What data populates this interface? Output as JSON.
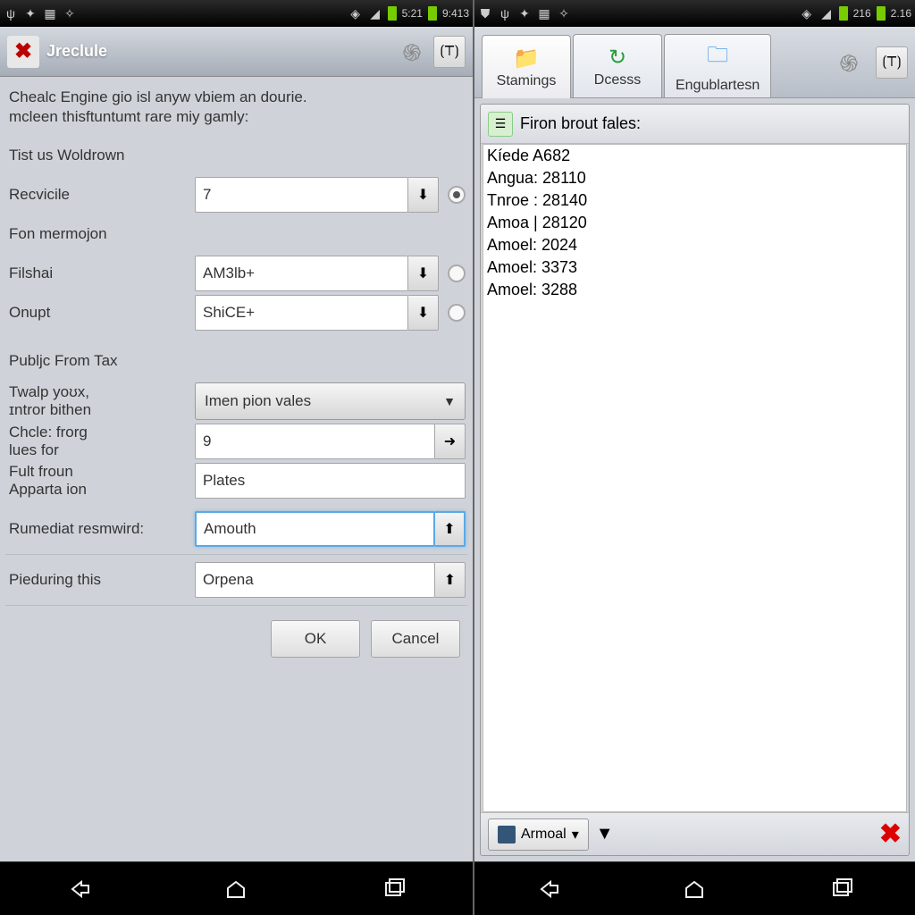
{
  "left": {
    "status": {
      "time": "5:21",
      "extra": "9:413"
    },
    "title": "Jreclule",
    "intro1": "Chealc Engine gio isl anyw vbiem an dourie.",
    "intro2": "mcleen thisftuntumt rare miy gamly:",
    "rows": {
      "woldrown": "Tist us Woldrown",
      "recvicile": "Recvicile",
      "recvicile_val": "7",
      "fon": "Fon mermojon",
      "filshal": "Filshai",
      "filshal_val": "AM3lb+",
      "onupt": "Onupt",
      "onupt_val": "ShiCE+",
      "publiq": "Publjc From Tax",
      "twalp": "Twalp yoʊx,",
      "intror": "ɪntror bithen",
      "select_val": "Imen pion vales",
      "chcle": "Chcle: frorg",
      "chcle_val": "9",
      "lues": "lues for",
      "fult": "Fult froun",
      "fult_val": "Plates",
      "apparta": "Apparta ion",
      "rumediat": "Rumediat resmwird:",
      "rumediat_val": "Amouth",
      "pieduring": "Pieduring this",
      "pieduring_val": "Orpena"
    },
    "buttons": {
      "ok": "OK",
      "cancel": "Cancel"
    }
  },
  "right": {
    "status": {
      "sig": "216",
      "bat": "2.16"
    },
    "tabs": {
      "t1": "Stamings",
      "t2": "Dcesss",
      "t3": "Engublartesn"
    },
    "panel_title": "Firon brout fales:",
    "items": [
      "Kíede A682",
      "Angua: 28110",
      "Tnroe : 28140",
      "Amoa | 28120",
      "Amoel: 2024",
      "Amoel: 3373",
      "Amoel: 3288"
    ],
    "foot_label": "Armoal"
  }
}
